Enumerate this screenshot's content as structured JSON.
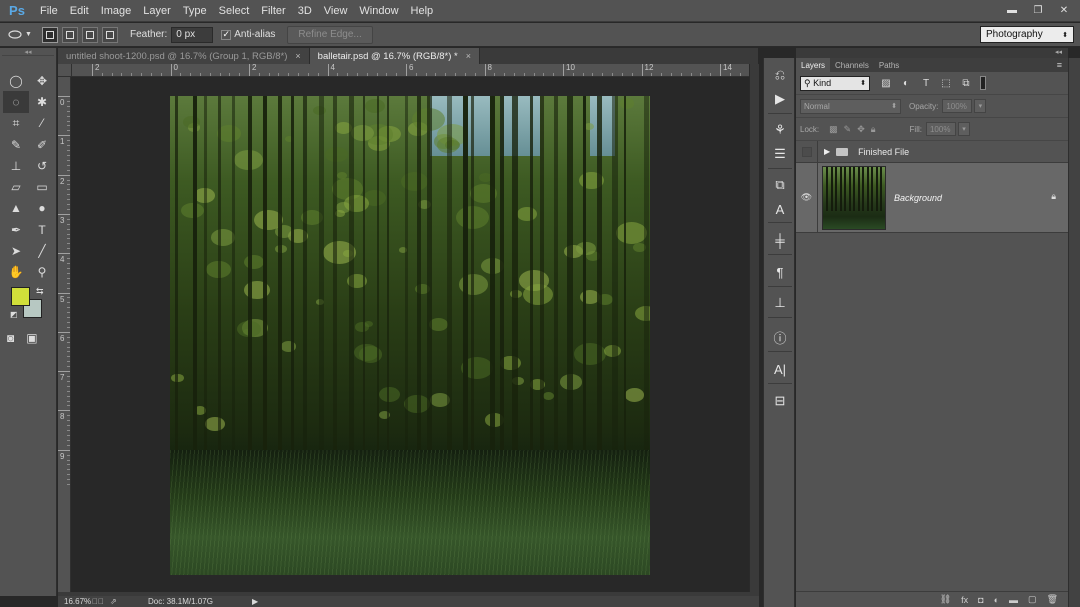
{
  "menu": {
    "logo": "Ps",
    "items": [
      "File",
      "Edit",
      "Image",
      "Layer",
      "Type",
      "Select",
      "Filter",
      "3D",
      "View",
      "Window",
      "Help"
    ]
  },
  "window_controls": {
    "minimize": "▬",
    "restore": "❐",
    "close": "✕"
  },
  "options": {
    "feather_label": "Feather:",
    "feather_value": "0 px",
    "antialias_label": "Anti-alias",
    "antialias_checked": "✓",
    "refine_edge": "Refine Edge...",
    "workspace": "Photography"
  },
  "tabs": [
    {
      "label": "untitled shoot-1200.psd @ 16.7% (Group 1, RGB/8*)",
      "close": "×"
    },
    {
      "label": "balletair.psd @ 16.7% (RGB/8*) *",
      "close": "×"
    }
  ],
  "ruler": {
    "h_labels": [
      "2",
      "0",
      "2",
      "4",
      "6",
      "8",
      "10",
      "12",
      "14"
    ],
    "v_labels": [
      "0",
      "1",
      "2",
      "3",
      "4",
      "5",
      "6",
      "7",
      "8",
      "9"
    ]
  },
  "colors": {
    "foreground": "#d1df3a",
    "background": "#b7c8c2"
  },
  "status": {
    "zoom": "16.67%",
    "doc": "Doc: 38.1M/1.07G"
  },
  "layers_panel": {
    "tabs": [
      "Layers",
      "Channels",
      "Paths"
    ],
    "filter_kind": "Kind",
    "blend_mode": "Normal",
    "opacity_label": "Opacity:",
    "opacity_value": "100%",
    "lock_label": "Lock:",
    "fill_label": "Fill:",
    "fill_value": "100%",
    "layers": [
      {
        "name": "Finished File",
        "type": "group"
      },
      {
        "name": "Background",
        "type": "image"
      }
    ]
  }
}
